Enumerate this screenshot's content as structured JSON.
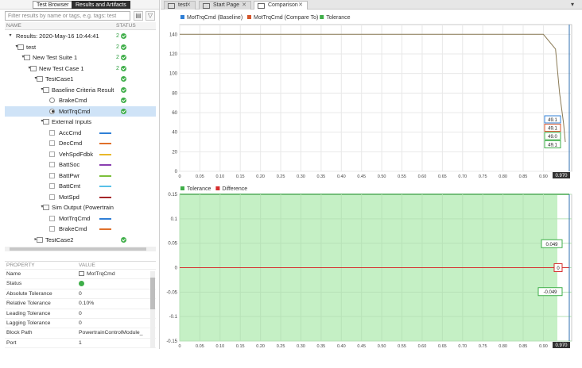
{
  "left_panel": {
    "tabs": [
      "Test Browser",
      "Results and Artifacts"
    ],
    "search_placeholder": "Filter results by name or tags, e.g. tags: test",
    "columns": {
      "name": "NAME",
      "status": "STATUS"
    },
    "tree": [
      {
        "label": "Results: 2020-May-16 10:44:41",
        "indent": 0,
        "twisty": "down",
        "icon": "none",
        "status": "2",
        "ok": true
      },
      {
        "label": "test",
        "indent": 1,
        "twisty": "down",
        "icon": "file",
        "status": "2",
        "ok": true
      },
      {
        "label": "New Test Suite 1",
        "indent": 2,
        "twisty": "down",
        "icon": "folder",
        "status": "2",
        "ok": true
      },
      {
        "label": "New Test Case 1",
        "indent": 3,
        "twisty": "down",
        "icon": "file",
        "status": "2",
        "ok": true
      },
      {
        "label": "TestCase1",
        "indent": 4,
        "twisty": "down",
        "icon": "file",
        "status": "",
        "ok": true
      },
      {
        "label": "Baseline Criteria Result",
        "indent": 5,
        "twisty": "down",
        "icon": "doc",
        "status": "",
        "ok": true
      },
      {
        "label": "BrakeCmd",
        "indent": 6,
        "twisty": "none",
        "icon": "radio",
        "status": "",
        "ok": true
      },
      {
        "label": "MotTrqCmd",
        "indent": 6,
        "twisty": "none",
        "icon": "radio-on",
        "status": "",
        "ok": true,
        "selected": true
      },
      {
        "label": "External Inputs",
        "indent": 5,
        "twisty": "down",
        "icon": "doc",
        "status": "",
        "ok": false
      },
      {
        "label": "AccCmd",
        "indent": 6,
        "twisty": "none",
        "icon": "check",
        "status": "",
        "ok": false,
        "color": "#2f7fd6"
      },
      {
        "label": "DecCmd",
        "indent": 6,
        "twisty": "none",
        "icon": "check",
        "status": "",
        "ok": false,
        "color": "#e0702a"
      },
      {
        "label": "VehSpdFdbk",
        "indent": 6,
        "twisty": "none",
        "icon": "check",
        "status": "",
        "ok": false,
        "color": "#e8b82a"
      },
      {
        "label": "BattSoc",
        "indent": 6,
        "twisty": "none",
        "icon": "check",
        "status": "",
        "ok": false,
        "color": "#8a3fb0"
      },
      {
        "label": "BattPwr",
        "indent": 6,
        "twisty": "none",
        "icon": "check",
        "status": "",
        "ok": false,
        "color": "#7cbf3a"
      },
      {
        "label": "BattCmt",
        "indent": 6,
        "twisty": "none",
        "icon": "check",
        "status": "",
        "ok": false,
        "color": "#58c0e8"
      },
      {
        "label": "MotSpd",
        "indent": 6,
        "twisty": "none",
        "icon": "check",
        "status": "",
        "ok": false,
        "color": "#a5262a"
      },
      {
        "label": "Sim Output (Powertrain",
        "indent": 5,
        "twisty": "down",
        "icon": "doc",
        "status": "",
        "ok": false
      },
      {
        "label": "MotTrqCmd",
        "indent": 6,
        "twisty": "none",
        "icon": "check",
        "status": "",
        "ok": false,
        "color": "#2f7fd6"
      },
      {
        "label": "BrakeCmd",
        "indent": 6,
        "twisty": "none",
        "icon": "check",
        "status": "",
        "ok": false,
        "color": "#e0702a"
      },
      {
        "label": "TestCase2",
        "indent": 4,
        "twisty": "right",
        "icon": "file",
        "status": "",
        "ok": true
      }
    ],
    "properties": {
      "headers": {
        "property": "PROPERTY",
        "value": "VALUE"
      },
      "rows": [
        {
          "key": "Name",
          "value": "MotTrqCmd",
          "icon": "signal-icon"
        },
        {
          "key": "Status",
          "value": "",
          "icon": "ok-icon"
        },
        {
          "key": "Absolute Tolerance",
          "value": "0"
        },
        {
          "key": "Relative Tolerance",
          "value": "0.10%"
        },
        {
          "key": "Leading Tolerance",
          "value": "0"
        },
        {
          "key": "Lagging Tolerance",
          "value": "0"
        },
        {
          "key": "Block Path",
          "value": "PowertrainControlModule_"
        },
        {
          "key": "Port",
          "value": "1"
        }
      ]
    }
  },
  "doc_tabs": [
    {
      "label": "test",
      "active": false
    },
    {
      "label": "Start Page",
      "active": false
    },
    {
      "label": "Comparison",
      "active": true
    }
  ],
  "chart_data": [
    {
      "type": "line",
      "legend": [
        {
          "name": "MotTrqCmd (Baseline)",
          "color": "#2f7fd6"
        },
        {
          "name": "MotTrqCmd (Compare To)",
          "color": "#d4552b"
        },
        {
          "name": "Tolerance",
          "color": "#3fae49"
        }
      ],
      "xlim": [
        0,
        0.97
      ],
      "ylim": [
        0,
        150
      ],
      "xticks": [
        "0",
        "0.05",
        "0.10",
        "0.15",
        "0.20",
        "0.25",
        "0.30",
        "0.35",
        "0.40",
        "0.45",
        "0.50",
        "0.55",
        "0.60",
        "0.65",
        "0.70",
        "0.75",
        "0.80",
        "0.85",
        "0.90"
      ],
      "yticks": [
        0,
        20,
        40,
        60,
        80,
        100,
        120,
        140
      ],
      "series": [
        {
          "name": "MotTrqCmd (Baseline)",
          "x": [
            0,
            0.9,
            0.93,
            0.94,
            0.95,
            0.97
          ],
          "y": [
            140,
            140,
            125,
            80,
            49.1,
            30
          ]
        }
      ],
      "cursor_x": "0.970",
      "cursor_values": [
        {
          "text": "49.1",
          "color": "#2f7fd6"
        },
        {
          "text": "49.1",
          "color": "#d4552b"
        },
        {
          "text": "49.0",
          "color": "#3fae49"
        },
        {
          "text": "49.1",
          "color": "#3fae49"
        }
      ]
    },
    {
      "type": "area",
      "legend": [
        {
          "name": "Tolerance",
          "color": "#3fae49"
        },
        {
          "name": "Difference",
          "color": "#d62d2d"
        }
      ],
      "xlim": [
        0,
        0.97
      ],
      "ylim": [
        -0.15,
        0.15
      ],
      "xticks": [
        "0",
        "0.05",
        "0.10",
        "0.15",
        "0.20",
        "0.25",
        "0.30",
        "0.35",
        "0.40",
        "0.45",
        "0.50",
        "0.55",
        "0.60",
        "0.65",
        "0.70",
        "0.75",
        "0.80",
        "0.85",
        "0.90"
      ],
      "yticks": [
        "0.15",
        "0.1",
        "0.05",
        "0",
        "-0.05",
        "-0.1",
        "-0.15"
      ],
      "tolerance_band": [
        -0.15,
        0.15
      ],
      "difference": 0,
      "cursor_x": "0.970",
      "cursor_values": [
        {
          "text": "0.049",
          "color": "#3fae49"
        },
        {
          "text": "0",
          "color": "#d62d2d"
        },
        {
          "text": "-0.049",
          "color": "#3fae49"
        }
      ]
    }
  ]
}
